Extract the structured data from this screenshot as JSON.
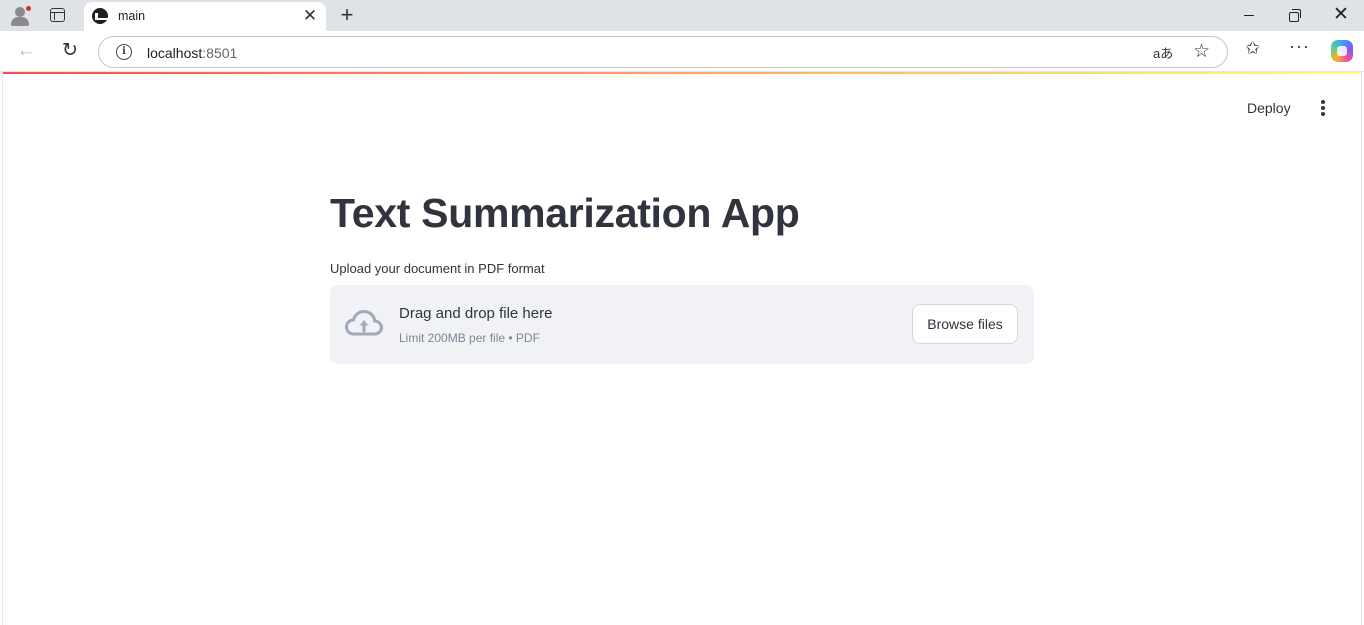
{
  "browser": {
    "tab_title": "main",
    "tab_close_glyph": "✕",
    "new_tab_glyph": "+",
    "close_glyph": "✕",
    "back_glyph": "←",
    "reload_glyph": "↻",
    "url_host": "localhost",
    "url_port": ":8501",
    "read_aloud_glyph": "aあ",
    "star_glyph": "☆",
    "favorites_glyph": "✩",
    "more_glyph": "···"
  },
  "header": {
    "deploy_label": "Deploy"
  },
  "main": {
    "title": "Text Summarization App",
    "uploader": {
      "label": "Upload your document in PDF format",
      "drop_text": "Drag and drop file here",
      "limit_text": "Limit 200MB per file • PDF",
      "browse_label": "Browse files"
    }
  },
  "colors": {
    "primary_text": "#31333f",
    "dropzone_bg": "#f0f2f6",
    "muted_text": "#808495",
    "decoration_start": "#ff4b4b",
    "decoration_end": "#fffd80"
  }
}
